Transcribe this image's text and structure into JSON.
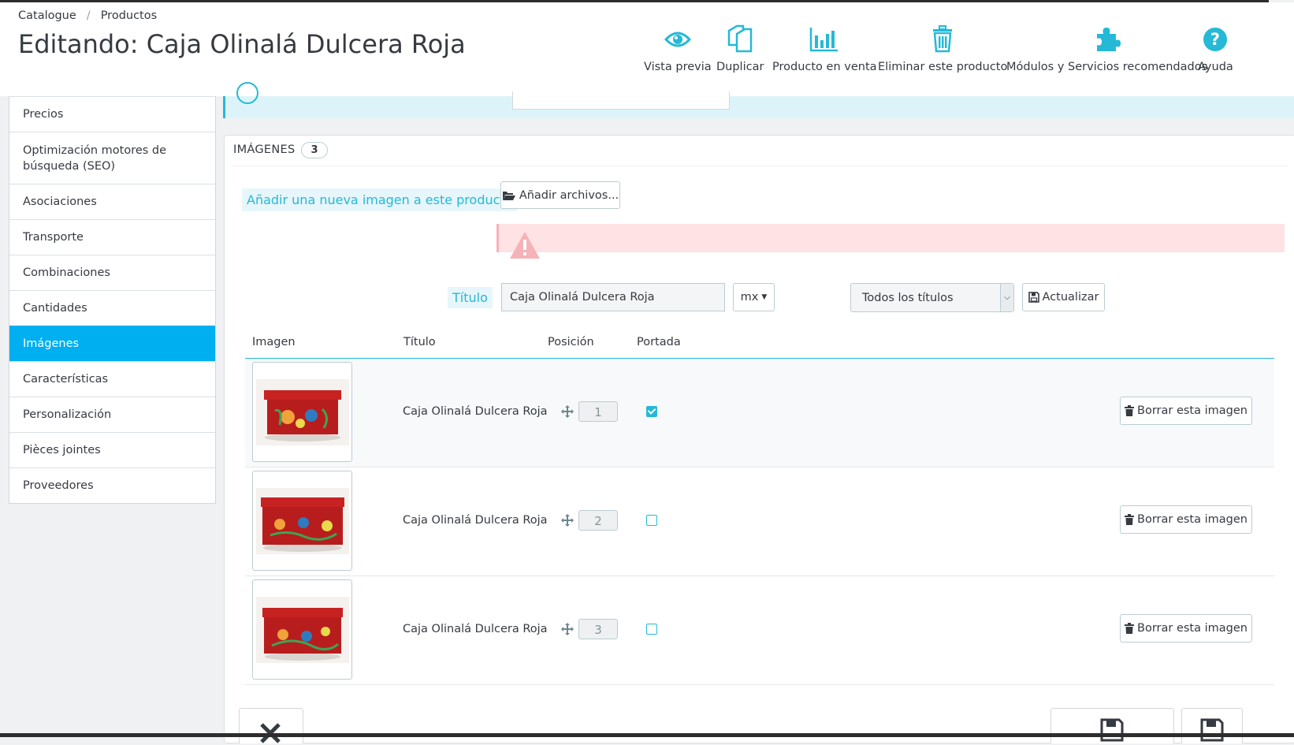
{
  "header": {
    "breadcrumb": [
      "Catalogue",
      "Productos"
    ],
    "title": "Editando: Caja Olinalá Dulcera Roja",
    "toolbar": [
      {
        "label": "Vista previa",
        "icon": "eye-icon"
      },
      {
        "label": "Duplicar",
        "icon": "copy-icon"
      },
      {
        "label": "Producto en venta",
        "icon": "bar-chart-icon"
      },
      {
        "label": "Eliminar este producto",
        "icon": "trash-icon"
      },
      {
        "label": "Módulos y Servicios recomendados",
        "icon": "puzzle-icon"
      },
      {
        "label": "Ayuda",
        "icon": "help-icon"
      }
    ]
  },
  "sidebar": {
    "items": [
      {
        "label": "Precios"
      },
      {
        "label": "Optimización motores de búsqueda (SEO)"
      },
      {
        "label": "Asociaciones"
      },
      {
        "label": "Transporte"
      },
      {
        "label": "Combinaciones"
      },
      {
        "label": "Cantidades"
      },
      {
        "label": "Imágenes",
        "active": true
      },
      {
        "label": "Características"
      },
      {
        "label": "Personalización"
      },
      {
        "label": "Pièces jointes"
      },
      {
        "label": "Proveedores"
      }
    ]
  },
  "images_panel": {
    "heading": "IMÁGENES",
    "count": "3",
    "add_label": "Añadir una nueva imagen a este producto",
    "add_button": "Añadir archivos...",
    "title_label": "Título",
    "title_value": "Caja Olinalá Dulcera Roja",
    "lang_button": "mx",
    "titles_select": "Todos los títulos",
    "update_button": "Actualizar",
    "columns": [
      "Imagen",
      "Título",
      "Posición",
      "Portada"
    ],
    "rows": [
      {
        "title": "Caja Olinalá Dulcera Roja",
        "position": "1",
        "cover": true,
        "delete_label": "Borrar esta imagen"
      },
      {
        "title": "Caja Olinalá Dulcera Roja",
        "position": "2",
        "cover": false,
        "delete_label": "Borrar esta imagen"
      },
      {
        "title": "Caja Olinalá Dulcera Roja",
        "position": "3",
        "cover": false,
        "delete_label": "Borrar esta imagen"
      }
    ]
  },
  "colors": {
    "accent": "#25b9d7",
    "active_tab": "#00aff0",
    "text": "#363a41",
    "alert_bg": "#ffe2e4"
  }
}
